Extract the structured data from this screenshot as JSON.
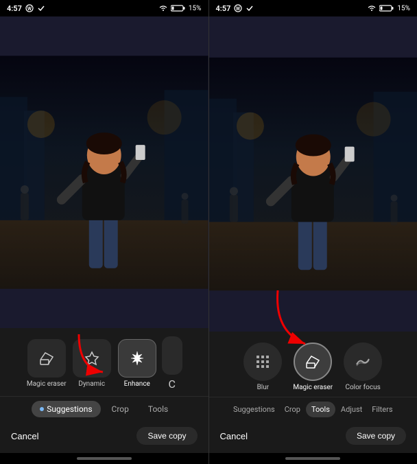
{
  "panels": [
    {
      "id": "left",
      "statusBar": {
        "time": "4:57",
        "battery": "15%"
      },
      "tools": [
        {
          "id": "magic-eraser",
          "label": "Magic eraser",
          "icon": "eraser",
          "highlighted": false
        },
        {
          "id": "dynamic",
          "label": "Dynamic",
          "icon": "dynamic",
          "highlighted": false
        },
        {
          "id": "enhance",
          "label": "Enhance",
          "icon": "enhance",
          "highlighted": true
        },
        {
          "id": "more",
          "label": "C",
          "icon": "more",
          "highlighted": false
        }
      ],
      "tabs": [
        {
          "id": "suggestions",
          "label": "Suggestions",
          "active": true,
          "pill": true
        },
        {
          "id": "crop",
          "label": "Crop",
          "active": false
        },
        {
          "id": "tools-tab",
          "label": "Tools",
          "active": false
        }
      ],
      "actions": {
        "cancel": "Cancel",
        "save": "Save copy"
      },
      "hasArrow": true,
      "arrowTarget": "crop-tab"
    },
    {
      "id": "right",
      "statusBar": {
        "time": "4:57",
        "battery": "15%"
      },
      "circleTools": [
        {
          "id": "blur",
          "label": "Blur",
          "icon": "grid",
          "active": false
        },
        {
          "id": "magic-eraser",
          "label": "Magic eraser",
          "icon": "eraser",
          "active": true
        },
        {
          "id": "color-focus",
          "label": "Color focus",
          "icon": "rainbow",
          "active": false
        }
      ],
      "tabs": [
        {
          "id": "suggestions",
          "label": "Suggestions",
          "active": false,
          "pill": false
        },
        {
          "id": "crop",
          "label": "Crop",
          "active": false
        },
        {
          "id": "tools-tab",
          "label": "Tools",
          "active": true
        },
        {
          "id": "adjust",
          "label": "Adjust",
          "active": false
        },
        {
          "id": "filters",
          "label": "Filters",
          "active": false
        }
      ],
      "actions": {
        "cancel": "Cancel",
        "save": "Save copy"
      },
      "hasArrow": true,
      "arrowTarget": "magic-eraser-circle"
    }
  ],
  "copyText": "Copy",
  "cropText": "Crop"
}
